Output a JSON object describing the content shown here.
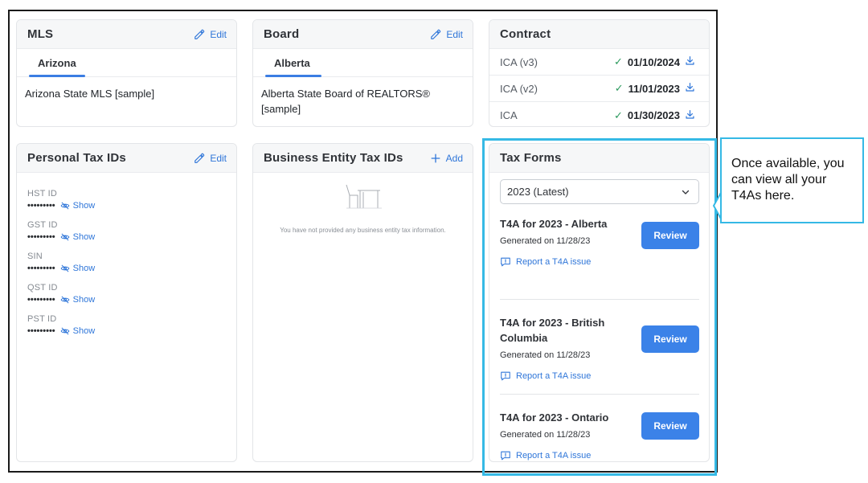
{
  "mls": {
    "title": "MLS",
    "edit_label": "Edit",
    "tab": "Arizona",
    "text": "Arizona State MLS [sample]"
  },
  "board": {
    "title": "Board",
    "edit_label": "Edit",
    "tab": "Alberta",
    "text": "Alberta State Board of REALTORS® [sample]"
  },
  "contract": {
    "title": "Contract",
    "rows": [
      {
        "name": "ICA (v3)",
        "date": "01/10/2024"
      },
      {
        "name": "ICA (v2)",
        "date": "11/01/2023"
      },
      {
        "name": "ICA",
        "date": "01/30/2023"
      }
    ]
  },
  "personal_tax": {
    "title": "Personal Tax IDs",
    "edit_label": "Edit",
    "mask": "•••••••••",
    "show_label": "Show",
    "fields": [
      "HST ID",
      "GST ID",
      "SIN",
      "QST ID",
      "PST ID"
    ]
  },
  "business_tax": {
    "title": "Business Entity Tax IDs",
    "add_label": "Add",
    "empty_text": "You have not provided any business entity tax information."
  },
  "tax_forms": {
    "title": "Tax Forms",
    "year_selected": "2023 (Latest)",
    "review_label": "Review",
    "report_label": "Report a T4A issue",
    "items": [
      {
        "title": "T4A for 2023 - Alberta",
        "generated": "Generated on 11/28/23"
      },
      {
        "title": "T4A for 2023 - British Columbia",
        "generated": "Generated on 11/28/23"
      },
      {
        "title": "T4A for 2023 - Ontario",
        "generated": "Generated on 11/28/23"
      }
    ]
  },
  "callout": {
    "text": "Once available, you can view all your T4As here."
  },
  "colors": {
    "accent": "#3b82e8",
    "link": "#2f76d9",
    "highlight": "#35b9e5",
    "check": "#2c9a5e"
  }
}
